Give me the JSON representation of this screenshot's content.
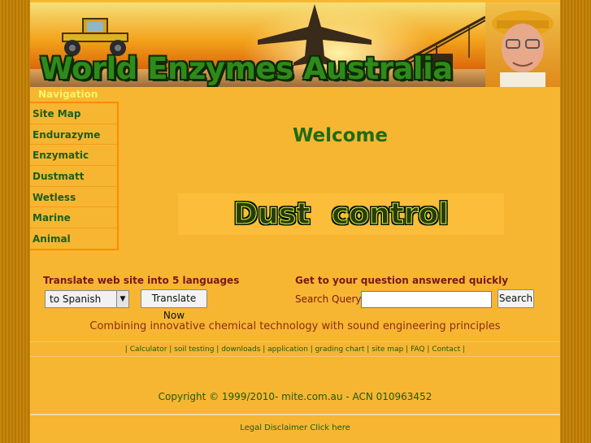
{
  "header": {
    "title": "World Enzymes Australia"
  },
  "navigation": {
    "heading": "Navigation",
    "items": [
      {
        "label": "Site Map"
      },
      {
        "label": "Endurazyme"
      },
      {
        "label": "Enzymatic"
      },
      {
        "label": "Dustmatt"
      },
      {
        "label": "Wetless"
      },
      {
        "label": "Marine"
      },
      {
        "label": "Animal"
      }
    ]
  },
  "main": {
    "welcome": "Welcome",
    "dust_banner": "Dust control"
  },
  "translate": {
    "title": "Translate web site into 5 languages",
    "selected_language": "to Spanish",
    "button_label": "Translate Now"
  },
  "search": {
    "title": "Get to your question answered quickly",
    "label": "Search Query",
    "input_value": "",
    "button_label": "Search"
  },
  "tagline": "Combining innovative chemical technology with sound engineering principles",
  "footer_links": {
    "prefix": "| ",
    "items": [
      "Calculator",
      "soil testing",
      "downloads",
      "application",
      "grading chart",
      "site map",
      "FAQ",
      "Contact"
    ],
    "separator": " | ",
    "suffix": " |"
  },
  "copyright": "Copyright © 1999/2010- mite.com.au - ACN 010963452",
  "disclaimer": "Legal Disclaimer Click here",
  "colors": {
    "page_bg": "#f7b631",
    "nav_border": "#ff8c00",
    "nav_text": "#1b5e1b",
    "heading_red": "#7a1818",
    "welcome_green": "#1f6b12"
  }
}
